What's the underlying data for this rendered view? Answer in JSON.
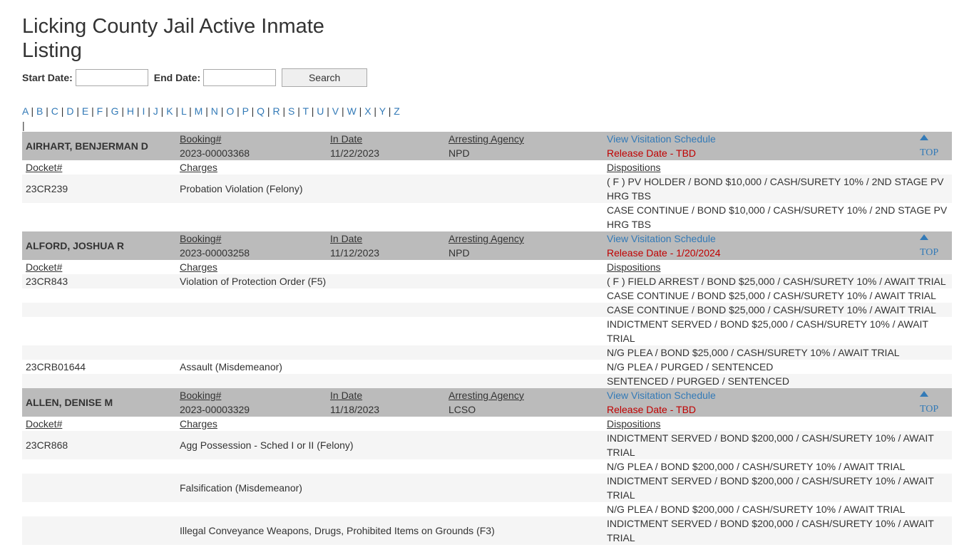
{
  "page": {
    "title": "Licking County Jail Active Inmate Listing"
  },
  "search": {
    "start_label": "Start Date:",
    "end_label": "End Date:",
    "button_label": "Search",
    "start_value": "",
    "end_value": ""
  },
  "alphabet": [
    "A",
    "B",
    "C",
    "D",
    "E",
    "F",
    "G",
    "H",
    "I",
    "J",
    "K",
    "L",
    "M",
    "N",
    "O",
    "P",
    "Q",
    "R",
    "S",
    "T",
    "U",
    "V",
    "W",
    "X",
    "Y",
    "Z"
  ],
  "labels": {
    "booking": "Booking#",
    "in_date": "In Date",
    "agency": "Arresting Agency",
    "visitation": "View Visitation Schedule",
    "top": "TOP",
    "docket": "Docket#",
    "charges": "Charges",
    "dispositions": "Dispositions"
  },
  "inmates": [
    {
      "name": "AIRHART, BENJERMAN D",
      "booking": "2023-00003368",
      "in_date": "11/22/2023",
      "agency": "NPD",
      "release": "Release Date - TBD",
      "rows": [
        {
          "docket": "23CR239",
          "charge": "Probation Violation (Felony)",
          "disposition": "( F ) PV HOLDER / BOND $10,000 / CASH/SURETY 10% / 2ND STAGE PV HRG TBS"
        },
        {
          "docket": "",
          "charge": "",
          "disposition": "CASE CONTINUE / BOND $10,000 / CASH/SURETY 10% / 2ND STAGE PV HRG TBS"
        }
      ]
    },
    {
      "name": "ALFORD, JOSHUA R",
      "booking": "2023-00003258",
      "in_date": "11/12/2023",
      "agency": "NPD",
      "release": "Release Date - 1/20/2024",
      "rows": [
        {
          "docket": "23CR843",
          "charge": "Violation of Protection Order (F5)",
          "disposition": "( F ) FIELD ARREST / BOND $25,000 / CASH/SURETY 10% / AWAIT TRIAL"
        },
        {
          "docket": "",
          "charge": "",
          "disposition": "CASE CONTINUE / BOND $25,000 / CASH/SURETY 10% / AWAIT TRIAL"
        },
        {
          "docket": "",
          "charge": "",
          "disposition": "CASE CONTINUE / BOND $25,000 / CASH/SURETY 10% / AWAIT TRIAL"
        },
        {
          "docket": "",
          "charge": "",
          "disposition": "INDICTMENT SERVED / BOND $25,000 / CASH/SURETY 10% / AWAIT TRIAL"
        },
        {
          "docket": "",
          "charge": "",
          "disposition": "N/G PLEA / BOND $25,000 / CASH/SURETY 10% / AWAIT TRIAL"
        },
        {
          "docket": "23CRB01644",
          "charge": "Assault (Misdemeanor)",
          "disposition": "N/G PLEA / PURGED / SENTENCED"
        },
        {
          "docket": "",
          "charge": "",
          "disposition": "SENTENCED / PURGED / SENTENCED"
        }
      ]
    },
    {
      "name": "ALLEN, DENISE M",
      "booking": "2023-00003329",
      "in_date": "11/18/2023",
      "agency": "LCSO",
      "release": "Release Date - TBD",
      "rows": [
        {
          "docket": "23CR868",
          "charge": "Agg Possession - Sched I or II (Felony)",
          "disposition": "INDICTMENT SERVED / BOND $200,000 / CASH/SURETY 10% / AWAIT TRIAL"
        },
        {
          "docket": "",
          "charge": "",
          "disposition": "N/G PLEA / BOND $200,000 / CASH/SURETY 10% / AWAIT TRIAL"
        },
        {
          "docket": "",
          "charge": "Falsification (Misdemeanor)",
          "disposition": "INDICTMENT SERVED / BOND $200,000 / CASH/SURETY 10% / AWAIT TRIAL"
        },
        {
          "docket": "",
          "charge": "",
          "disposition": "N/G PLEA / BOND $200,000 / CASH/SURETY 10% / AWAIT TRIAL"
        },
        {
          "docket": "",
          "charge": "Illegal Conveyance Weapons, Drugs, Prohibited Items on Grounds (F3)",
          "disposition": "INDICTMENT SERVED / BOND $200,000 / CASH/SURETY 10% / AWAIT TRIAL"
        }
      ]
    }
  ]
}
